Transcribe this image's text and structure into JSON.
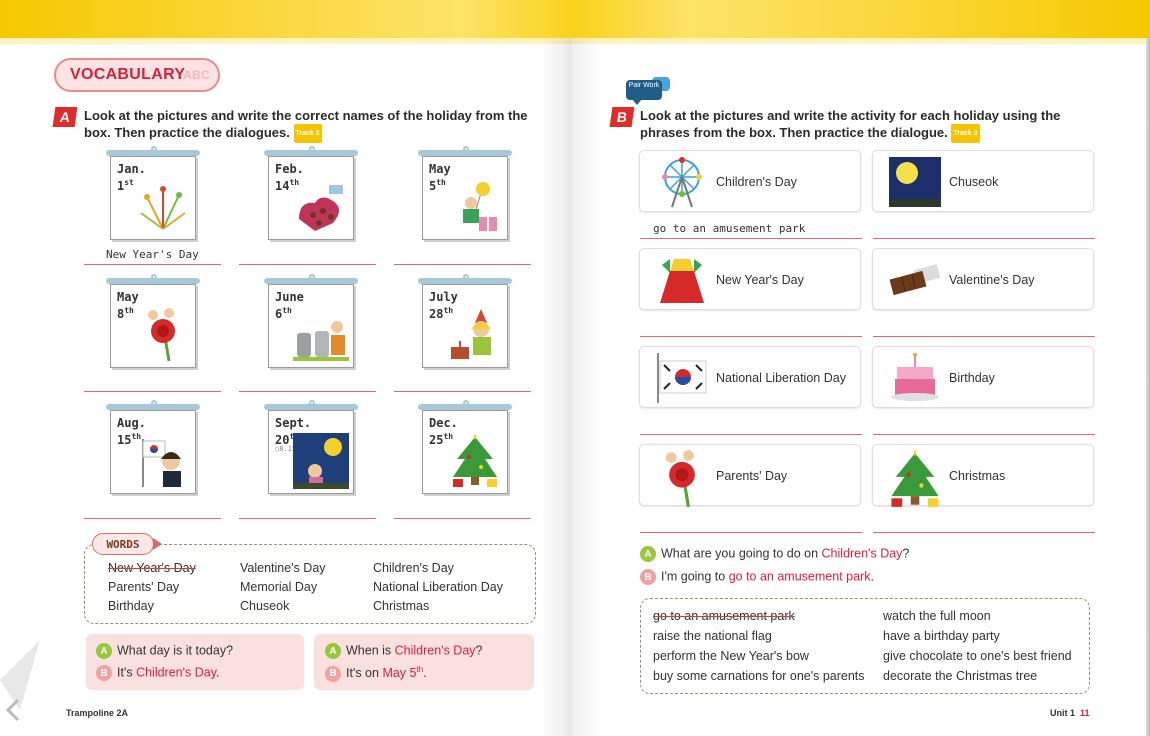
{
  "left_page": {
    "vocab_title": "VOCABULARY",
    "vocab_deco": "ABC",
    "section_a_letter": "A",
    "section_a_instruction_line1": "Look at the pictures and write the correct names of the holiday from the",
    "section_a_instruction_line2": "box. Then practice the dialogues.",
    "track_a": "Track 2",
    "calendars": [
      {
        "month": "Jan.",
        "day": "1",
        "sup": "st",
        "extra": "",
        "icon": "fireworks-icon",
        "answer": "New Year's Day"
      },
      {
        "month": "Feb.",
        "day": "14",
        "sup": "th",
        "extra": "",
        "icon": "chocolate-box-icon",
        "answer": ""
      },
      {
        "month": "May",
        "day": "5",
        "sup": "th",
        "extra": "",
        "icon": "child-with-balloon-icon",
        "answer": ""
      },
      {
        "month": "May",
        "day": "8",
        "sup": "th",
        "extra": "",
        "icon": "carnation-icon",
        "answer": ""
      },
      {
        "month": "June",
        "day": "6",
        "sup": "th",
        "extra": "",
        "icon": "memorial-graves-icon",
        "answer": ""
      },
      {
        "month": "July",
        "day": "28",
        "sup": "th",
        "extra": "",
        "icon": "birthday-girl-icon",
        "answer": ""
      },
      {
        "month": "Aug.",
        "day": "15",
        "sup": "th",
        "extra": "",
        "icon": "korean-flag-girl-icon",
        "answer": ""
      },
      {
        "month": "Sept.",
        "day": "20",
        "sup": "th",
        "extra": "○8.15",
        "icon": "full-moon-night-icon",
        "answer": ""
      },
      {
        "month": "Dec.",
        "day": "25",
        "sup": "th",
        "extra": "",
        "icon": "christmas-tree-icon",
        "answer": ""
      }
    ],
    "words_title": "WORDS",
    "words": [
      [
        "New Year's Day",
        "Valentine's Day",
        "Children's Day"
      ],
      [
        "Parents' Day",
        "Memorial Day",
        "National Liberation Day"
      ],
      [
        "Birthday",
        "Chuseok",
        "Christmas"
      ]
    ],
    "dialogue1": {
      "a_role": "A",
      "b_role": "B",
      "a_text": "What day is it today?",
      "b_prefix": "It's ",
      "b_highlight": "Children's Day",
      "b_suffix": "."
    },
    "dialogue2": {
      "a_role": "A",
      "b_role": "B",
      "a_prefix": "When is ",
      "a_highlight": "Children's Day",
      "a_suffix": "?",
      "b_prefix": "It's on ",
      "b_highlight": "May 5",
      "b_sup": "th",
      "b_suffix": "."
    },
    "footer": "Trampoline 2A"
  },
  "right_page": {
    "pair_work": "Pair Work",
    "section_b_letter": "B",
    "section_b_instruction_line1": "Look at the pictures and write the activity for each holiday using the",
    "section_b_instruction_line2": "phrases from the box. Then practice the dialogue.",
    "track_b": "Track 3",
    "cards": [
      {
        "label": "Children's Day",
        "icon": "ferris-wheel-icon",
        "answer": "go to an amusement park"
      },
      {
        "label": "Chuseok",
        "icon": "full-moon-icon",
        "answer": ""
      },
      {
        "label": "New Year's Day",
        "icon": "hanbok-icon",
        "answer": ""
      },
      {
        "label": "Valentine's Day",
        "icon": "chocolate-bar-icon",
        "answer": ""
      },
      {
        "label": "National Liberation Day",
        "icon": "korean-flag-icon",
        "answer": ""
      },
      {
        "label": "Birthday",
        "icon": "birthday-cake-icon",
        "answer": ""
      },
      {
        "label": "Parents' Day",
        "icon": "carnation-icon",
        "answer": ""
      },
      {
        "label": "Christmas",
        "icon": "christmas-tree-icon",
        "answer": ""
      }
    ],
    "dialogue": {
      "a_role": "A",
      "b_role": "B",
      "a_prefix": "What are you going to do on ",
      "a_highlight": "Children's Day",
      "a_suffix": "?",
      "b_prefix": "I'm going to ",
      "b_highlight": "go to an amusement park",
      "b_suffix": "."
    },
    "phrases_left": [
      "go to an amusement park",
      "raise the national flag",
      "perform the New Year's bow",
      "buy some carnations for one's parents"
    ],
    "phrases_right": [
      "watch the full moon",
      "have a birthday party",
      "give chocolate to one's best friend",
      "decorate the Christmas tree"
    ],
    "footer_unit": "Unit 1",
    "footer_page": "11"
  },
  "colors": {
    "accent_red": "#d4223a",
    "banner_yellow": "#f6c800",
    "answer_line": "#e06a6a",
    "dialogue_bg": "#fbe0e0"
  }
}
